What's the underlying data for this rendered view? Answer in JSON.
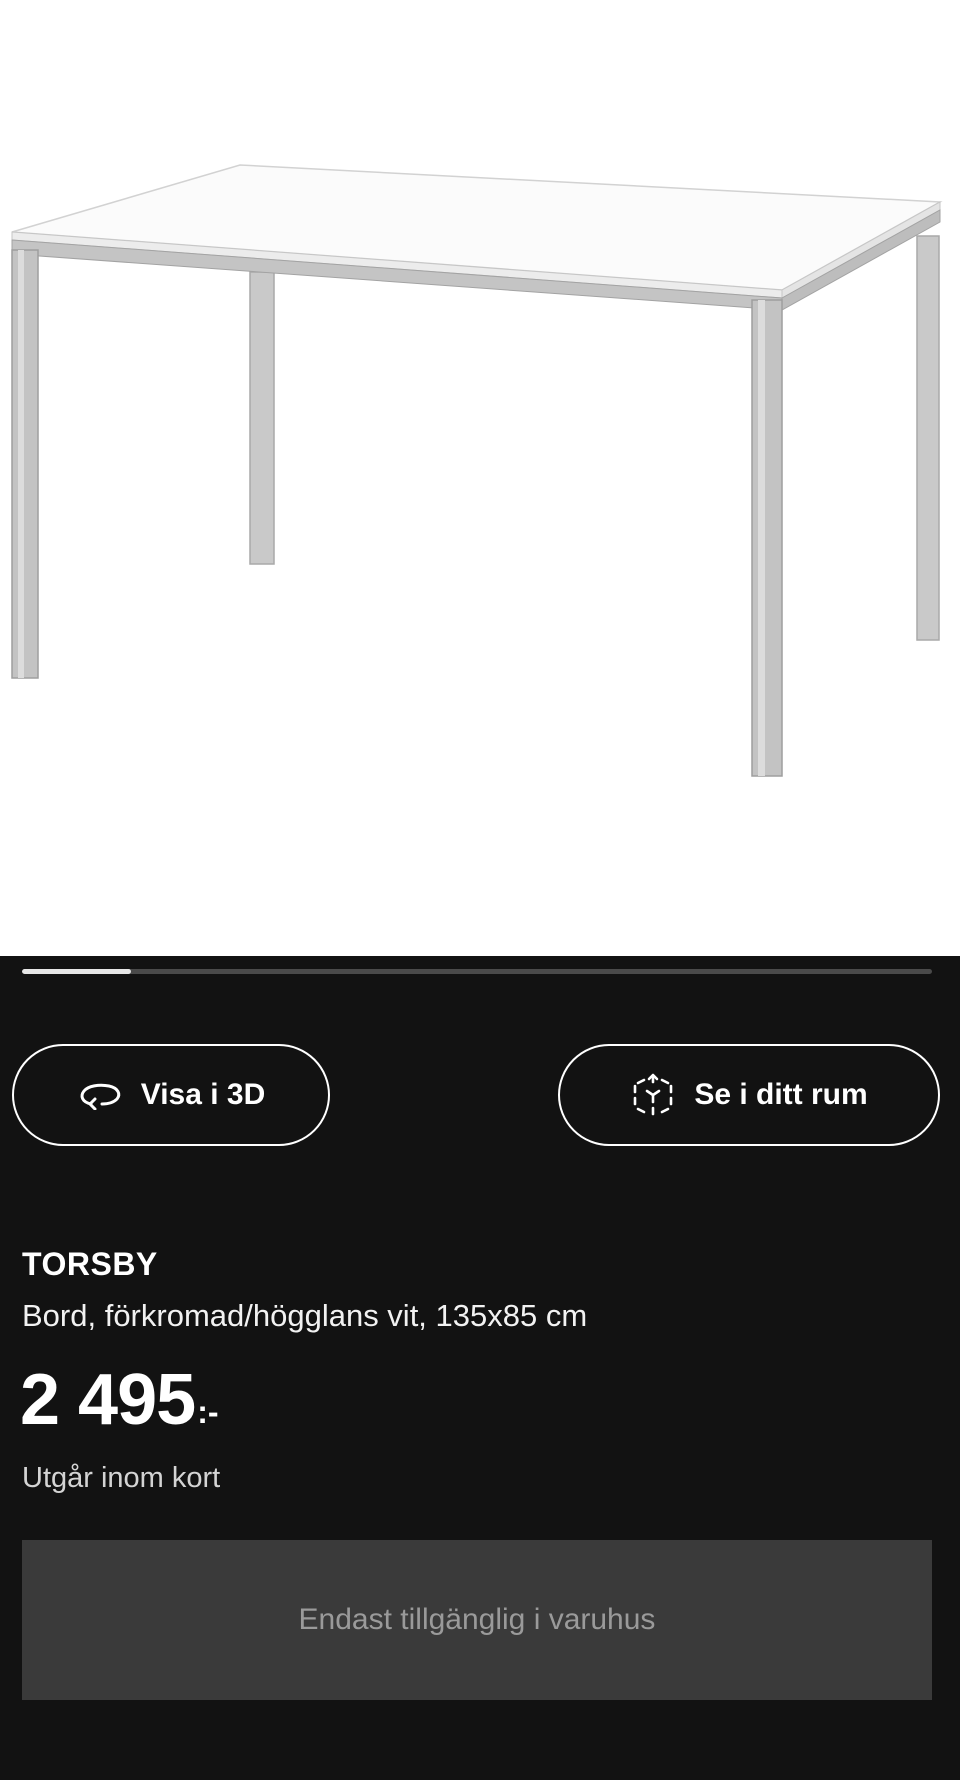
{
  "product": {
    "image_alt": "TORSBY table",
    "name": "TORSBY",
    "description": "Bord, förkromad/högglans vit, 135x85 cm",
    "price": {
      "value": "2 495",
      "suffix": ":-"
    },
    "availability_note": "Utgår inom kort"
  },
  "carousel": {
    "progress": 0.12
  },
  "actions": {
    "view_3d_label": "Visa i 3D",
    "view_3d_icon": "rotate-3d-icon",
    "view_in_room_label": "Se i ditt rum",
    "view_in_room_icon": "ar-cube-icon"
  },
  "purchase": {
    "status_label": "Endast tillgänglig i varuhus"
  },
  "colors": {
    "panel_background": "#121212",
    "button_border": "#ffffff",
    "disabled_background": "#3a3a3a",
    "disabled_text": "#9a9a9a"
  }
}
